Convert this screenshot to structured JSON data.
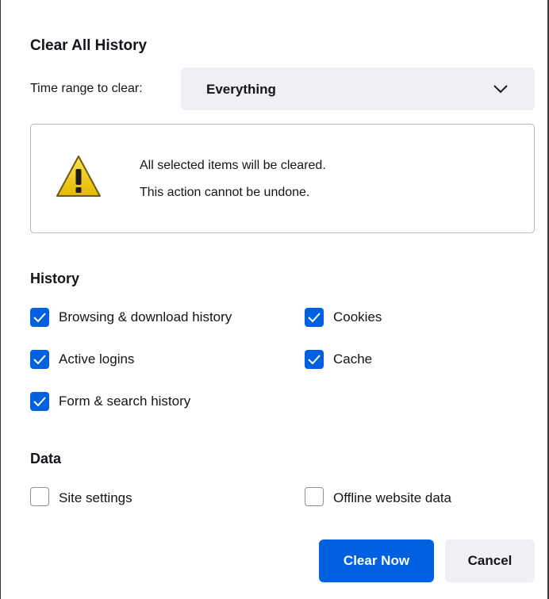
{
  "dialog": {
    "title": "Clear All History",
    "time_range": {
      "label": "Time range to clear:",
      "selected": "Everything",
      "icon": "chevron-down-icon"
    },
    "warning": {
      "icon": "warning-icon",
      "line1": "All selected items will be cleared.",
      "line2": "This action cannot be undone."
    },
    "history": {
      "heading": "History",
      "items": [
        {
          "label": "Browsing & download history",
          "checked": true
        },
        {
          "label": "Cookies",
          "checked": true
        },
        {
          "label": "Active logins",
          "checked": true
        },
        {
          "label": "Cache",
          "checked": true
        },
        {
          "label": "Form & search history",
          "checked": true
        }
      ]
    },
    "data": {
      "heading": "Data",
      "items": [
        {
          "label": "Site settings",
          "checked": false
        },
        {
          "label": "Offline website data",
          "checked": false
        }
      ]
    },
    "buttons": {
      "clear": "Clear Now",
      "cancel": "Cancel"
    },
    "colors": {
      "accent": "#0061e0",
      "warning_yellow": "#f4c400"
    }
  }
}
